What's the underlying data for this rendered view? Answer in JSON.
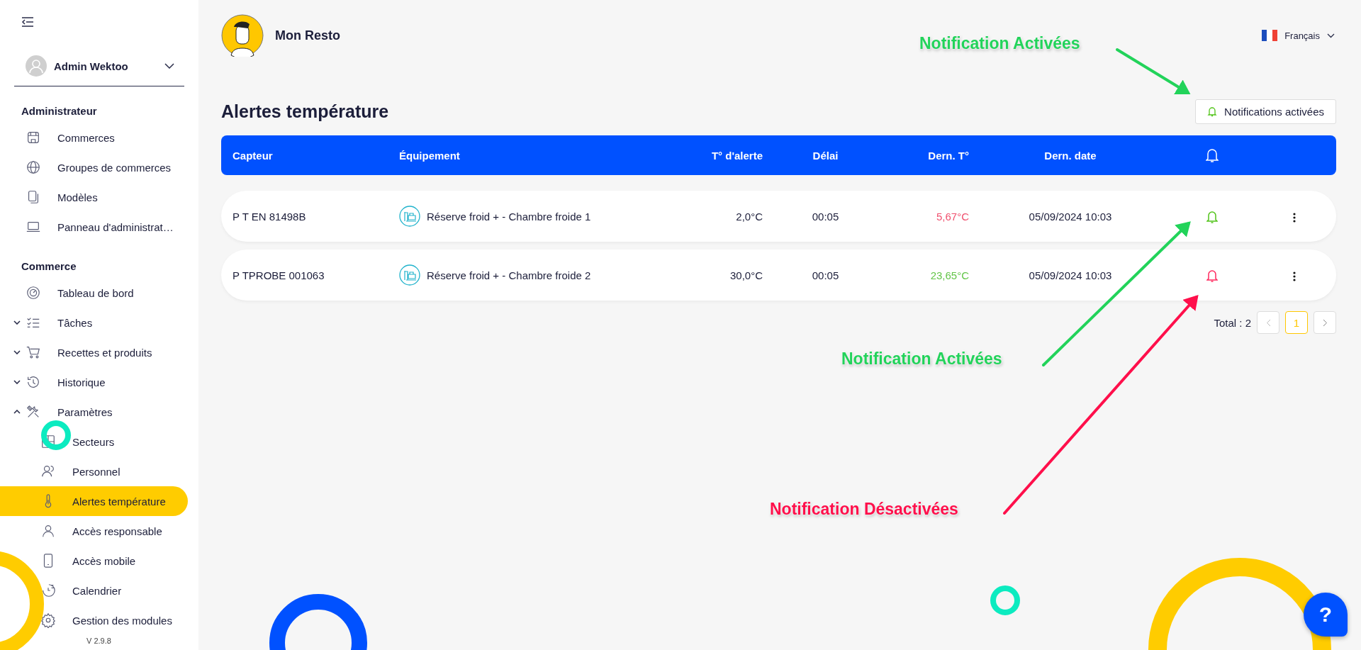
{
  "sidebar": {
    "user": "Admin Wektoo",
    "sections": [
      {
        "title": "Administrateur",
        "items": [
          {
            "label": "Commerces",
            "selected": false
          },
          {
            "label": "Groupes de commerces",
            "selected": false
          },
          {
            "label": "Modèles",
            "selected": false
          },
          {
            "label": "Panneau d'administrat…",
            "selected": false
          }
        ]
      },
      {
        "title": "Commerce",
        "items": [
          {
            "label": "Tableau de bord",
            "selected": false
          },
          {
            "label": "Tâches",
            "selected": false,
            "expanded": false
          },
          {
            "label": "Recettes et produits",
            "selected": false,
            "expanded": false
          },
          {
            "label": "Historique",
            "selected": false,
            "expanded": false
          },
          {
            "label": "Paramètres",
            "selected": false,
            "expanded": true,
            "children": [
              {
                "label": "Secteurs",
                "selected": false
              },
              {
                "label": "Personnel",
                "selected": false
              },
              {
                "label": "Alertes température",
                "selected": true
              },
              {
                "label": "Accès responsable",
                "selected": false
              },
              {
                "label": "Accès mobile",
                "selected": false
              },
              {
                "label": "Calendrier",
                "selected": false
              },
              {
                "label": "Gestion des modules",
                "selected": false
              }
            ]
          }
        ]
      }
    ],
    "version": "V 2.9.8"
  },
  "header": {
    "store": "Mon Resto",
    "language": "Français"
  },
  "page": {
    "title": "Alertes température",
    "notifications_button": {
      "label": "Notifications activées",
      "on": true
    }
  },
  "table": {
    "columns": [
      "Capteur",
      "Équipement",
      "T° d'alerte",
      "Délai",
      "Dern. T°",
      "Dern. date"
    ],
    "rows": [
      {
        "sensor": "P T EN 81498B",
        "equipment": "Réserve froid + - Chambre froide 1",
        "alert_temp": "2,0°C",
        "delay": "00:05",
        "last_temp": "5,67°C",
        "last_temp_alert": true,
        "last_date": "05/09/2024 10:03",
        "notifications": true
      },
      {
        "sensor": "P TPROBE 001063",
        "equipment": "Réserve froid + - Chambre froide 2",
        "alert_temp": "30,0°C",
        "delay": "00:05",
        "last_temp": "23,65°C",
        "last_temp_alert": false,
        "last_date": "05/09/2024 10:03",
        "notifications": false
      }
    ]
  },
  "pagination": {
    "total": "Total : 2",
    "pages": [
      {
        "label": "1",
        "selected": true
      }
    ]
  },
  "annotations": [
    {
      "text": "Notification Activées",
      "color": "#22d35a"
    },
    {
      "text": "Notification Activées",
      "color": "#22d35a"
    },
    {
      "text": "Notification Désactivées",
      "color": "#ff0f4b"
    }
  ],
  "help_button": "?"
}
